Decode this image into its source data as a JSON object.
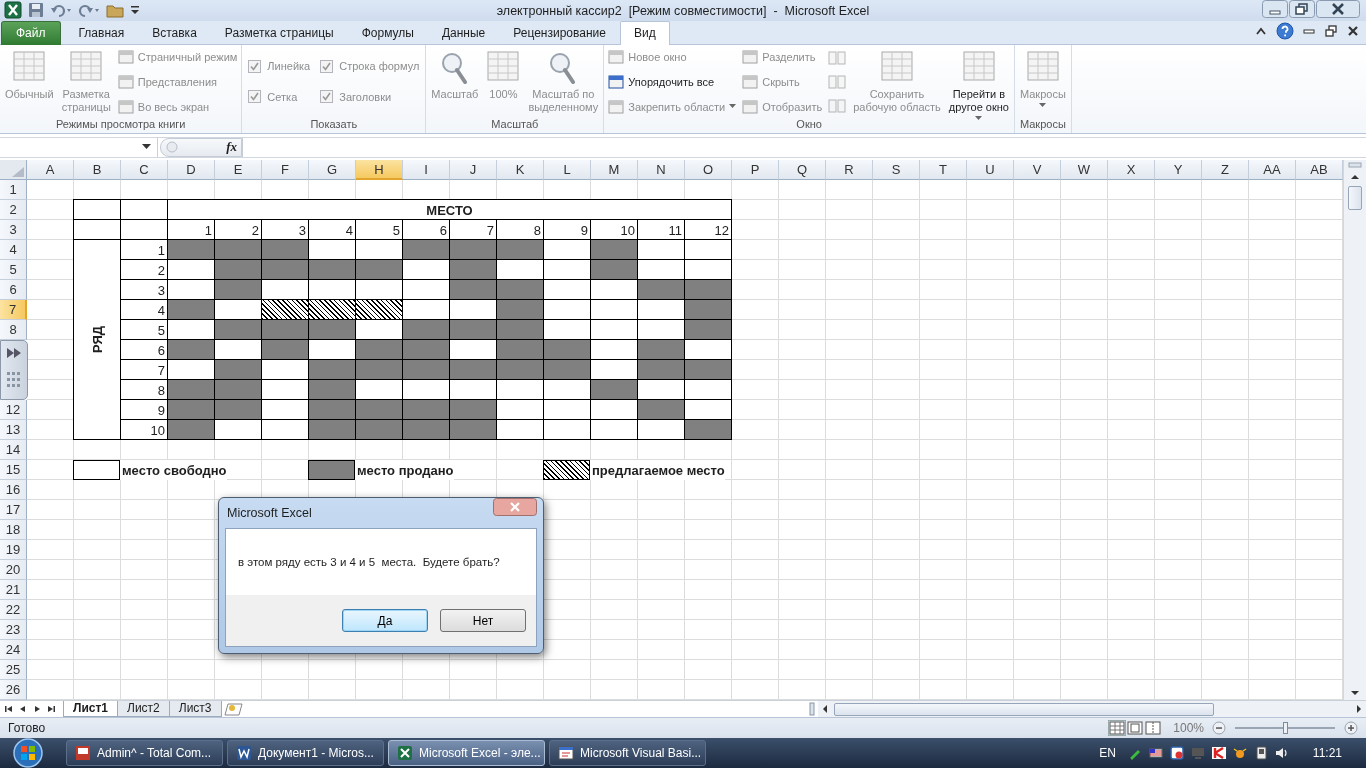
{
  "window": {
    "title": "электронный кассир2  [Режим совместимости]  -  Microsoft Excel"
  },
  "ribbon_tabs": [
    {
      "label": "Файл",
      "kind": "file",
      "selected": false
    },
    {
      "label": "Главная",
      "kind": "tab",
      "selected": false
    },
    {
      "label": "Вставка",
      "kind": "tab",
      "selected": false
    },
    {
      "label": "Разметка страницы",
      "kind": "tab",
      "selected": false
    },
    {
      "label": "Формулы",
      "kind": "tab",
      "selected": false
    },
    {
      "label": "Данные",
      "kind": "tab",
      "selected": false
    },
    {
      "label": "Рецензирование",
      "kind": "tab",
      "selected": false
    },
    {
      "label": "Вид",
      "kind": "tab",
      "selected": true
    }
  ],
  "ribbon_groups": [
    {
      "label": "Режимы просмотра книги",
      "columns": [
        {
          "kind": "large",
          "label": "Обычный",
          "disabled": true
        },
        {
          "kind": "large",
          "label": "Разметка\nстраницы",
          "disabled": true
        },
        {
          "kind": "stack",
          "items": [
            {
              "kind": "small",
              "label": "Страничный режим",
              "disabled": true
            },
            {
              "kind": "small",
              "label": "Представления",
              "disabled": true
            },
            {
              "kind": "small",
              "label": "Во весь экран",
              "disabled": true
            }
          ]
        }
      ]
    },
    {
      "label": "Показать",
      "columns": [
        {
          "kind": "stack",
          "items": [
            {
              "kind": "check",
              "label": "Линейка",
              "checked": true,
              "disabled": true
            },
            {
              "kind": "check",
              "label": "Сетка",
              "checked": true,
              "disabled": true
            }
          ]
        },
        {
          "kind": "stack",
          "items": [
            {
              "kind": "check",
              "label": "Строка формул",
              "checked": true,
              "disabled": true
            },
            {
              "kind": "check",
              "label": "Заголовки",
              "checked": true,
              "disabled": true
            }
          ]
        }
      ]
    },
    {
      "label": "Масштаб",
      "columns": [
        {
          "kind": "lens",
          "label": "Масштаб",
          "disabled": true
        },
        {
          "kind": "large",
          "label": "100%",
          "disabled": true
        },
        {
          "kind": "lens",
          "label": "Масштаб по\nвыделенному",
          "disabled": true
        }
      ]
    },
    {
      "label": "Окно",
      "columns": [
        {
          "kind": "stack",
          "items": [
            {
              "kind": "small",
              "label": "Новое окно",
              "disabled": true
            },
            {
              "kind": "small",
              "label": "Упорядочить все",
              "disabled": false
            },
            {
              "kind": "small",
              "label": "Закрепить области",
              "disabled": true,
              "dropdown": true
            }
          ]
        },
        {
          "kind": "stack",
          "items": [
            {
              "kind": "small",
              "label": "Разделить",
              "disabled": true
            },
            {
              "kind": "small",
              "label": "Скрыть",
              "disabled": true
            },
            {
              "kind": "small",
              "label": "Отобразить",
              "disabled": true
            }
          ]
        },
        {
          "kind": "stack",
          "items": [
            {
              "kind": "tiny",
              "disabled": true
            },
            {
              "kind": "tiny",
              "disabled": true
            },
            {
              "kind": "tiny",
              "disabled": true
            }
          ]
        },
        {
          "kind": "large",
          "label": "Сохранить\nрабочую область",
          "disabled": true
        },
        {
          "kind": "large",
          "label": "Перейти в\nдругое окно",
          "disabled": false,
          "dropdown": true
        }
      ]
    },
    {
      "label": "Макросы",
      "columns": [
        {
          "kind": "large",
          "label": "Макросы",
          "disabled": true,
          "dropdown": true
        }
      ]
    }
  ],
  "formula_bar": {
    "function_button": "fx"
  },
  "sheet": {
    "columns": [
      {
        "label": "A",
        "selected": false
      },
      {
        "label": "B",
        "selected": false
      },
      {
        "label": "C",
        "selected": false
      },
      {
        "label": "D",
        "selected": false
      },
      {
        "label": "E",
        "selected": false
      },
      {
        "label": "F",
        "selected": false
      },
      {
        "label": "G",
        "selected": false
      },
      {
        "label": "H",
        "selected": true
      },
      {
        "label": "I",
        "selected": false
      },
      {
        "label": "J",
        "selected": false
      },
      {
        "label": "K",
        "selected": false
      },
      {
        "label": "L",
        "selected": false
      },
      {
        "label": "M",
        "selected": false
      },
      {
        "label": "N",
        "selected": false
      },
      {
        "label": "O",
        "selected": false
      },
      {
        "label": "P",
        "selected": false
      },
      {
        "label": "Q",
        "selected": false
      },
      {
        "label": "R",
        "selected": false
      },
      {
        "label": "S",
        "selected": false
      },
      {
        "label": "T",
        "selected": false
      },
      {
        "label": "U",
        "selected": false
      },
      {
        "label": "V",
        "selected": false
      },
      {
        "label": "W",
        "selected": false
      },
      {
        "label": "X",
        "selected": false
      },
      {
        "label": "Y",
        "selected": false
      },
      {
        "label": "Z",
        "selected": false
      },
      {
        "label": "AA",
        "selected": false
      },
      {
        "label": "AB",
        "selected": false
      }
    ],
    "rows": [
      {
        "label": "1",
        "selected": false
      },
      {
        "label": "2",
        "selected": false
      },
      {
        "label": "3",
        "selected": false
      },
      {
        "label": "4",
        "selected": false
      },
      {
        "label": "5",
        "selected": false
      },
      {
        "label": "6",
        "selected": false
      },
      {
        "label": "7",
        "selected": true
      },
      {
        "label": "8",
        "selected": false
      },
      {
        "covered": true
      },
      {
        "covered": true
      },
      {
        "covered": true
      },
      {
        "label": "12",
        "selected": false
      },
      {
        "label": "13",
        "selected": false
      },
      {
        "label": "14",
        "selected": false
      },
      {
        "label": "15",
        "selected": false
      },
      {
        "label": "16",
        "selected": false
      },
      {
        "label": "17",
        "selected": false
      },
      {
        "label": "18",
        "selected": false
      },
      {
        "label": "19",
        "selected": false
      },
      {
        "label": "20",
        "selected": false
      },
      {
        "label": "21",
        "selected": false
      },
      {
        "label": "22",
        "selected": false
      },
      {
        "label": "23",
        "selected": false
      },
      {
        "label": "24",
        "selected": false
      },
      {
        "label": "25",
        "selected": false
      },
      {
        "label": "26",
        "selected": false
      }
    ]
  },
  "seat_table": {
    "title": "МЕСТО",
    "row_label": "РЯД",
    "seat_numbers": [
      "1",
      "2",
      "3",
      "4",
      "5",
      "6",
      "7",
      "8",
      "9",
      "10",
      "11",
      "12"
    ],
    "rows": [
      {
        "label": "1",
        "seats": [
          {
            "sold": true,
            "offered": false
          },
          {
            "sold": true,
            "offered": false
          },
          {
            "sold": true,
            "offered": false
          },
          {
            "sold": false,
            "offered": false
          },
          {
            "sold": false,
            "offered": false
          },
          {
            "sold": true,
            "offered": false
          },
          {
            "sold": true,
            "offered": false
          },
          {
            "sold": true,
            "offered": false
          },
          {
            "sold": false,
            "offered": false
          },
          {
            "sold": true,
            "offered": false
          },
          {
            "sold": false,
            "offered": false
          },
          {
            "sold": false,
            "offered": false
          }
        ]
      },
      {
        "label": "2",
        "seats": [
          {
            "sold": false,
            "offered": false
          },
          {
            "sold": true,
            "offered": false
          },
          {
            "sold": true,
            "offered": false
          },
          {
            "sold": true,
            "offered": false
          },
          {
            "sold": true,
            "offered": false
          },
          {
            "sold": false,
            "offered": false
          },
          {
            "sold": true,
            "offered": false
          },
          {
            "sold": false,
            "offered": false
          },
          {
            "sold": false,
            "offered": false
          },
          {
            "sold": true,
            "offered": false
          },
          {
            "sold": false,
            "offered": false
          },
          {
            "sold": false,
            "offered": false
          }
        ]
      },
      {
        "label": "3",
        "seats": [
          {
            "sold": false,
            "offered": false
          },
          {
            "sold": true,
            "offered": false
          },
          {
            "sold": false,
            "offered": false
          },
          {
            "sold": false,
            "offered": false
          },
          {
            "sold": false,
            "offered": false
          },
          {
            "sold": false,
            "offered": false
          },
          {
            "sold": true,
            "offered": false
          },
          {
            "sold": true,
            "offered": false
          },
          {
            "sold": false,
            "offered": false
          },
          {
            "sold": false,
            "offered": false
          },
          {
            "sold": true,
            "offered": false
          },
          {
            "sold": true,
            "offered": false
          }
        ]
      },
      {
        "label": "4",
        "seats": [
          {
            "sold": true,
            "offered": false
          },
          {
            "sold": false,
            "offered": false
          },
          {
            "sold": false,
            "offered": true
          },
          {
            "sold": false,
            "offered": true
          },
          {
            "sold": false,
            "offered": true
          },
          {
            "sold": false,
            "offered": false
          },
          {
            "sold": false,
            "offered": false
          },
          {
            "sold": true,
            "offered": false
          },
          {
            "sold": false,
            "offered": false
          },
          {
            "sold": false,
            "offered": false
          },
          {
            "sold": false,
            "offered": false
          },
          {
            "sold": true,
            "offered": false
          }
        ]
      },
      {
        "label": "5",
        "seats": [
          {
            "sold": false,
            "offered": false
          },
          {
            "sold": true,
            "offered": false
          },
          {
            "sold": true,
            "offered": false
          },
          {
            "sold": true,
            "offered": false
          },
          {
            "sold": false,
            "offered": false
          },
          {
            "sold": true,
            "offered": false
          },
          {
            "sold": true,
            "offered": false
          },
          {
            "sold": true,
            "offered": false
          },
          {
            "sold": false,
            "offered": false
          },
          {
            "sold": false,
            "offered": false
          },
          {
            "sold": false,
            "offered": false
          },
          {
            "sold": true,
            "offered": false
          }
        ]
      },
      {
        "label": "6",
        "seats": [
          {
            "sold": true,
            "offered": false
          },
          {
            "sold": false,
            "offered": false
          },
          {
            "sold": true,
            "offered": false
          },
          {
            "sold": false,
            "offered": false
          },
          {
            "sold": true,
            "offered": false
          },
          {
            "sold": true,
            "offered": false
          },
          {
            "sold": false,
            "offered": false
          },
          {
            "sold": true,
            "offered": false
          },
          {
            "sold": true,
            "offered": false
          },
          {
            "sold": false,
            "offered": false
          },
          {
            "sold": true,
            "offered": false
          },
          {
            "sold": false,
            "offered": false
          }
        ]
      },
      {
        "label": "7",
        "seats": [
          {
            "sold": false,
            "offered": false
          },
          {
            "sold": true,
            "offered": false
          },
          {
            "sold": false,
            "offered": false
          },
          {
            "sold": true,
            "offered": false
          },
          {
            "sold": true,
            "offered": false
          },
          {
            "sold": true,
            "offered": false
          },
          {
            "sold": true,
            "offered": false
          },
          {
            "sold": true,
            "offered": false
          },
          {
            "sold": true,
            "offered": false
          },
          {
            "sold": false,
            "offered": false
          },
          {
            "sold": true,
            "offered": false
          },
          {
            "sold": true,
            "offered": false
          }
        ]
      },
      {
        "label": "8",
        "seats": [
          {
            "sold": true,
            "offered": false
          },
          {
            "sold": true,
            "offered": false
          },
          {
            "sold": false,
            "offered": false
          },
          {
            "sold": true,
            "offered": false
          },
          {
            "sold": false,
            "offered": false
          },
          {
            "sold": false,
            "offered": false
          },
          {
            "sold": false,
            "offered": false
          },
          {
            "sold": false,
            "offered": false
          },
          {
            "sold": false,
            "offered": false
          },
          {
            "sold": true,
            "offered": false
          },
          {
            "sold": false,
            "offered": false
          },
          {
            "sold": false,
            "offered": false
          }
        ]
      },
      {
        "label": "9",
        "seats": [
          {
            "sold": true,
            "offered": false
          },
          {
            "sold": true,
            "offered": false
          },
          {
            "sold": false,
            "offered": false
          },
          {
            "sold": true,
            "offered": false
          },
          {
            "sold": true,
            "offered": false
          },
          {
            "sold": true,
            "offered": false
          },
          {
            "sold": true,
            "offered": false
          },
          {
            "sold": false,
            "offered": false
          },
          {
            "sold": false,
            "offered": false
          },
          {
            "sold": false,
            "offered": false
          },
          {
            "sold": true,
            "offered": false
          },
          {
            "sold": false,
            "offered": false
          }
        ]
      },
      {
        "label": "10",
        "seats": [
          {
            "sold": true,
            "offered": false
          },
          {
            "sold": false,
            "offered": false
          },
          {
            "sold": false,
            "offered": false
          },
          {
            "sold": true,
            "offered": false
          },
          {
            "sold": true,
            "offered": false
          },
          {
            "sold": true,
            "offered": false
          },
          {
            "sold": true,
            "offered": false
          },
          {
            "sold": false,
            "offered": false
          },
          {
            "sold": false,
            "offered": false
          },
          {
            "sold": false,
            "offered": false
          },
          {
            "sold": false,
            "offered": false
          },
          {
            "sold": true,
            "offered": false
          }
        ]
      }
    ]
  },
  "legend": [
    {
      "kind": "free",
      "label": "место свободно"
    },
    {
      "kind": "sold",
      "label": "место продано"
    },
    {
      "kind": "offered",
      "label": "предлагаемое место"
    }
  ],
  "dialog": {
    "title": "Microsoft Excel",
    "message": "в этом ряду есть 3 и 4 и 5  места.  Будете брать?",
    "buttons": [
      {
        "label": "Да",
        "default": true
      },
      {
        "label": "Нет",
        "default": false
      }
    ]
  },
  "sheet_tabs": [
    {
      "label": "Лист1",
      "selected": true
    },
    {
      "label": "Лист2",
      "selected": false
    },
    {
      "label": "Лист3",
      "selected": false
    }
  ],
  "status_bar": {
    "status": "Готово",
    "zoom": "100%",
    "zoom_slider": {
      "level": 0.5
    }
  },
  "taskbar": {
    "tasks": [
      {
        "label": "Admin^ - Total Com...",
        "selected": false
      },
      {
        "label": "Документ1 - Micros...",
        "selected": false
      },
      {
        "label": "Microsoft Excel - эле...",
        "selected": true
      },
      {
        "label": "Microsoft Visual Basi...",
        "selected": false
      }
    ],
    "language": "EN",
    "clock": "11:21"
  }
}
